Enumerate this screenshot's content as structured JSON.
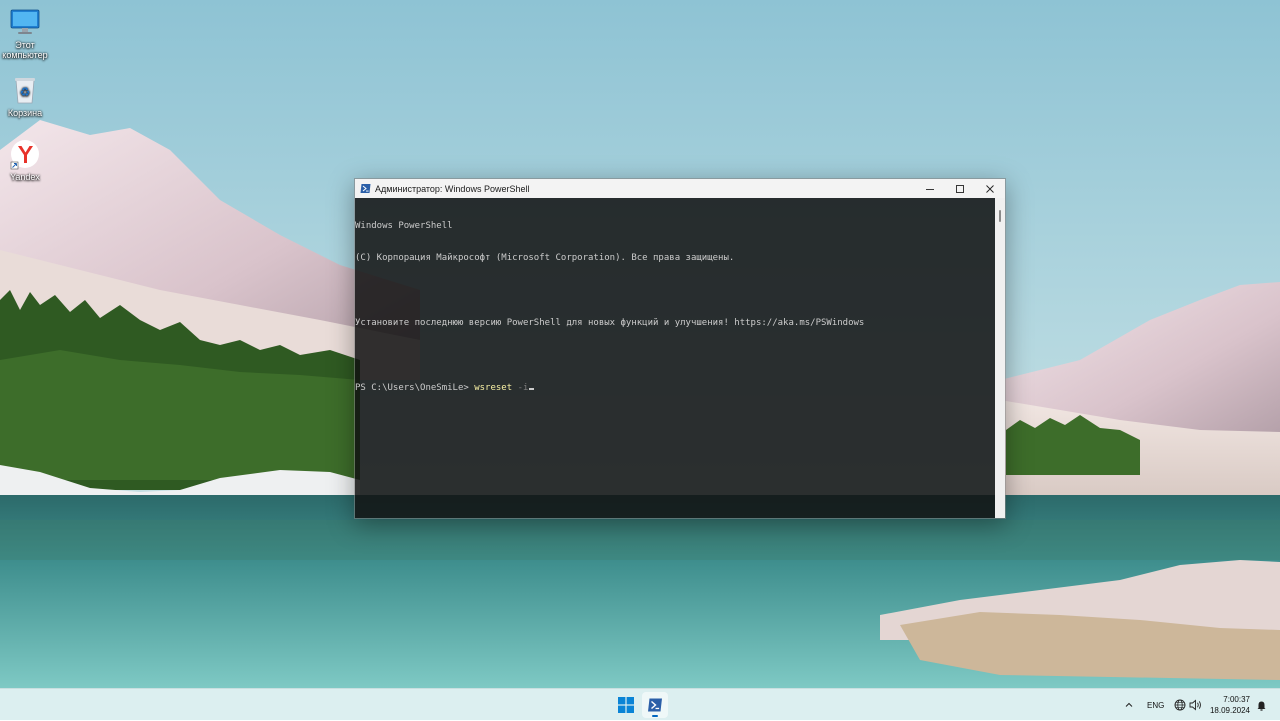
{
  "desktop": {
    "icons": [
      {
        "label": "Этот компьютер",
        "icon": "this-pc-icon"
      },
      {
        "label": "Корзина",
        "icon": "recycle-bin-icon"
      },
      {
        "label": "Yandex",
        "icon": "yandex-browser-icon"
      }
    ]
  },
  "window": {
    "title": "Администратор: Windows PowerShell",
    "app_icon": "powershell-icon",
    "controls": [
      "minimize-icon",
      "maximize-icon",
      "close-icon"
    ],
    "console": {
      "lines": [
        "Windows PowerShell",
        "(C) Корпорация Майкрософт (Microsoft Corporation). Все права защищены.",
        "",
        "Установите последнюю версию PowerShell для новых функций и улучшения! https://aka.ms/PSWindows",
        ""
      ],
      "prompt": "PS C:\\Users\\OneSmiLe> ",
      "command": "wsreset",
      "param": " -i"
    }
  },
  "taskbar": {
    "apps": [
      "windows-start-icon",
      "powershell-icon"
    ],
    "tray": {
      "chevron": "chevron-up-icon",
      "language": "ENG",
      "icons": [
        "network-icon",
        "volume-icon"
      ],
      "time": "7:00:37",
      "date": "18.09.2024",
      "notification_icon": "notification-icon"
    }
  }
}
